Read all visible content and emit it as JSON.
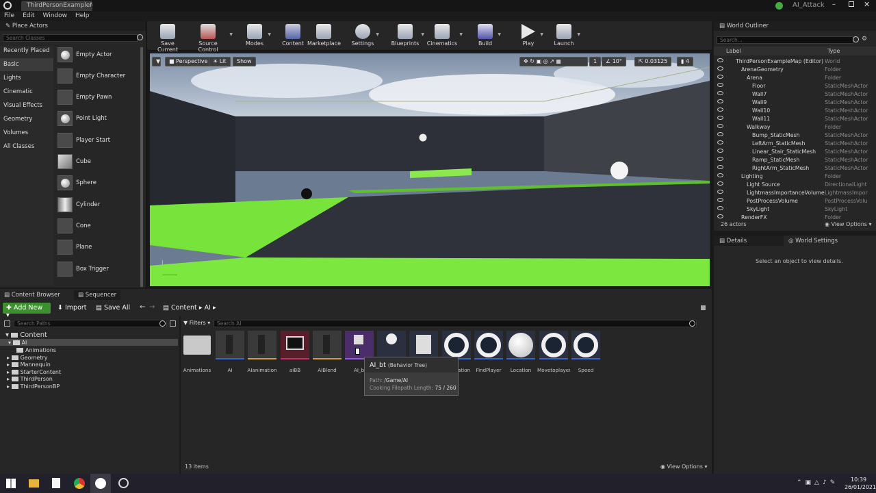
{
  "window": {
    "doc_tab": "ThirdPersonExampleMap*",
    "project": "AI_Attack"
  },
  "menu": [
    "File",
    "Edit",
    "Window",
    "Help"
  ],
  "place_actors": {
    "tab": "Place Actors",
    "search_placeholder": "Search Classes",
    "categories": [
      "Recently Placed",
      "Basic",
      "Lights",
      "Cinematic",
      "Visual Effects",
      "Geometry",
      "Volumes",
      "All Classes"
    ],
    "actors": [
      "Empty Actor",
      "Empty Character",
      "Empty Pawn",
      "Point Light",
      "Player Start",
      "Cube",
      "Sphere",
      "Cylinder",
      "Cone",
      "Plane",
      "Box Trigger"
    ]
  },
  "toolbar": [
    "Save Current",
    "Source Control",
    "Modes",
    "Content",
    "Marketplace",
    "Settings",
    "Blueprints",
    "Cinematics",
    "Build",
    "Play",
    "Launch"
  ],
  "viewport": {
    "perspective": "Perspective",
    "lit": "Lit",
    "show": "Show",
    "angle": "10°",
    "scale": "0.03125",
    "camspeed": "4",
    "grid": "1"
  },
  "outliner": {
    "tab": "World Outliner",
    "search_placeholder": "Search...",
    "col_label": "Label",
    "col_type": "Type",
    "rows": [
      {
        "label": "ThirdPersonExampleMap (Editor)",
        "type": "World"
      },
      {
        "label": "ArenaGeometry",
        "type": "Folder"
      },
      {
        "label": "Arena",
        "type": "Folder"
      },
      {
        "label": "Floor",
        "type": "StaticMeshActor"
      },
      {
        "label": "Wall7",
        "type": "StaticMeshActor"
      },
      {
        "label": "Wall9",
        "type": "StaticMeshActor"
      },
      {
        "label": "Wall10",
        "type": "StaticMeshActor"
      },
      {
        "label": "Wall11",
        "type": "StaticMeshActor"
      },
      {
        "label": "Walkway",
        "type": "Folder"
      },
      {
        "label": "Bump_StaticMesh",
        "type": "StaticMeshActor"
      },
      {
        "label": "LeftArm_StaticMesh",
        "type": "StaticMeshActor"
      },
      {
        "label": "Linear_Stair_StaticMesh",
        "type": "StaticMeshActor"
      },
      {
        "label": "Ramp_StaticMesh",
        "type": "StaticMeshActor"
      },
      {
        "label": "RightArm_StaticMesh",
        "type": "StaticMeshActor"
      },
      {
        "label": "Lighting",
        "type": "Folder"
      },
      {
        "label": "Light Source",
        "type": "DirectionalLight"
      },
      {
        "label": "LightmassImportanceVolume",
        "type": "LightmassImpor"
      },
      {
        "label": "PostProcessVolume",
        "type": "PostProcessVolu"
      },
      {
        "label": "SkyLight",
        "type": "SkyLight"
      },
      {
        "label": "RenderFX",
        "type": "Folder"
      }
    ],
    "count": "26 actors",
    "view_options": "View Options"
  },
  "details": {
    "tab": "Details",
    "world_settings": "World Settings",
    "empty": "Select an object to view details."
  },
  "content_browser": {
    "tab": "Content Browser",
    "sequencer": "Sequencer",
    "add_new": "Add New",
    "import": "Import",
    "save_all": "Save All",
    "crumbs": [
      "Content",
      "AI"
    ],
    "search_paths": "Search Paths",
    "filters": "Filters",
    "search_ai": "Search AI",
    "tree": [
      "Content",
      "AI",
      "Animations",
      "Geometry",
      "Mannequin",
      "StarterContent",
      "ThirdPerson",
      "ThirdPersonBP"
    ],
    "assets": [
      "Animations",
      "AI",
      "AIanimation",
      "aiBB",
      "AIBlend",
      "AI_bt",
      "",
      "",
      "ation",
      "FindPlayer",
      "Location",
      "Movetoplayer",
      "Speed"
    ],
    "tooltip": {
      "name": "AI_bt",
      "kind": "(Behavior Tree)",
      "path_label": "Path",
      "path": "/Game/AI",
      "cook_label": "Cooking Filepath Length",
      "cook_value": "75 / 260"
    },
    "item_count": "13 items",
    "view_options": "View Options"
  },
  "taskbar": {
    "time": "10:39",
    "date": "26/01/2021"
  }
}
